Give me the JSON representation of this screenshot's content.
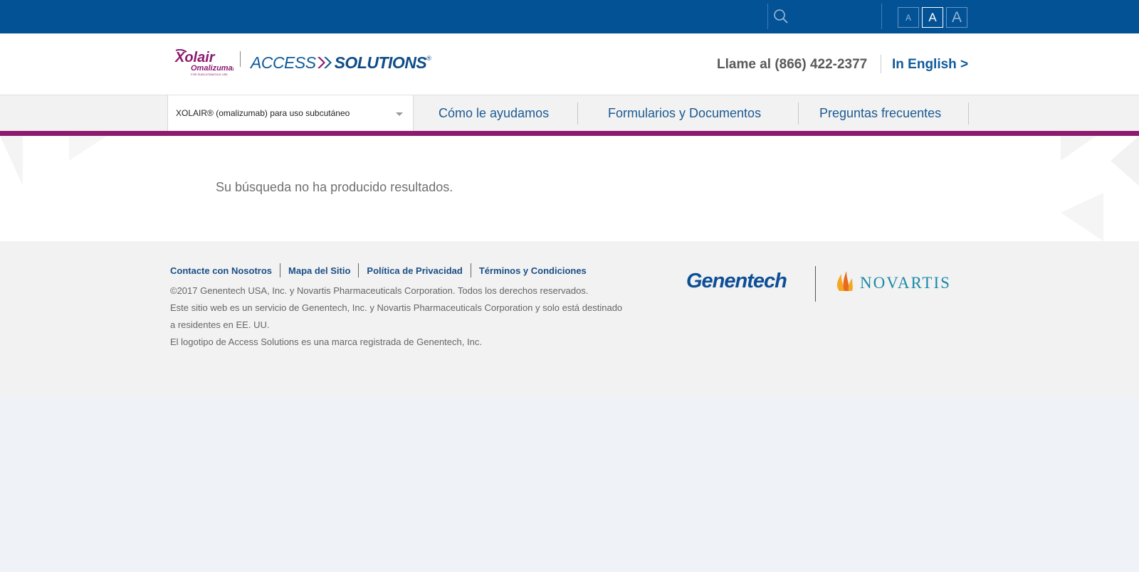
{
  "topbar": {
    "search_placeholder": "",
    "font_sizes": [
      {
        "label": "A",
        "active": false
      },
      {
        "label": "A",
        "active": true
      },
      {
        "label": "A",
        "active": false
      }
    ]
  },
  "header": {
    "logo_brand": "Xolair",
    "logo_brand_sub": "Omalizumab",
    "logo_brand_tiny": "FOR SUBCUTANEOUS USE",
    "logo_access_1": "ACCESS",
    "logo_access_2": "SOLUTIONS",
    "logo_reg": "®",
    "phone": "Llame al (866) 422-2377",
    "language_link": "In English >"
  },
  "nav": {
    "product_select": "XOLAIR® (omalizumab) para uso subcutáneo",
    "items": [
      "Cómo le ayudamos",
      "Formularios y Documentos",
      "Preguntas frecuentes"
    ]
  },
  "main": {
    "message": "Su búsqueda no ha producido resultados."
  },
  "footer": {
    "links": [
      "Contacte con Nosotros",
      "Mapa del Sitio",
      "Política de Privacidad",
      "Términos y Condiciones"
    ],
    "copyright": "©2017 Genentech USA, Inc. y Novartis Pharmaceuticals Corporation.  Todos los derechos reservados.",
    "disclaimer_1": "Este sitio web es un servicio de Genentech, Inc. y Novartis Pharmaceuticals Corporation y solo está destinado",
    "disclaimer_2": "a residentes en EE. UU.",
    "trademark": "El logotipo de Access Solutions es una marca registrada de Genentech, Inc.",
    "genentech_logo": "Genentech",
    "novartis_logo": "NOVARTIS"
  },
  "colors": {
    "topbar": "#035295",
    "accent_purple": "#8c1a6f",
    "link_blue": "#1a5a93",
    "footer_bg": "#f2f2f2",
    "page_bg": "#eff2f6"
  }
}
